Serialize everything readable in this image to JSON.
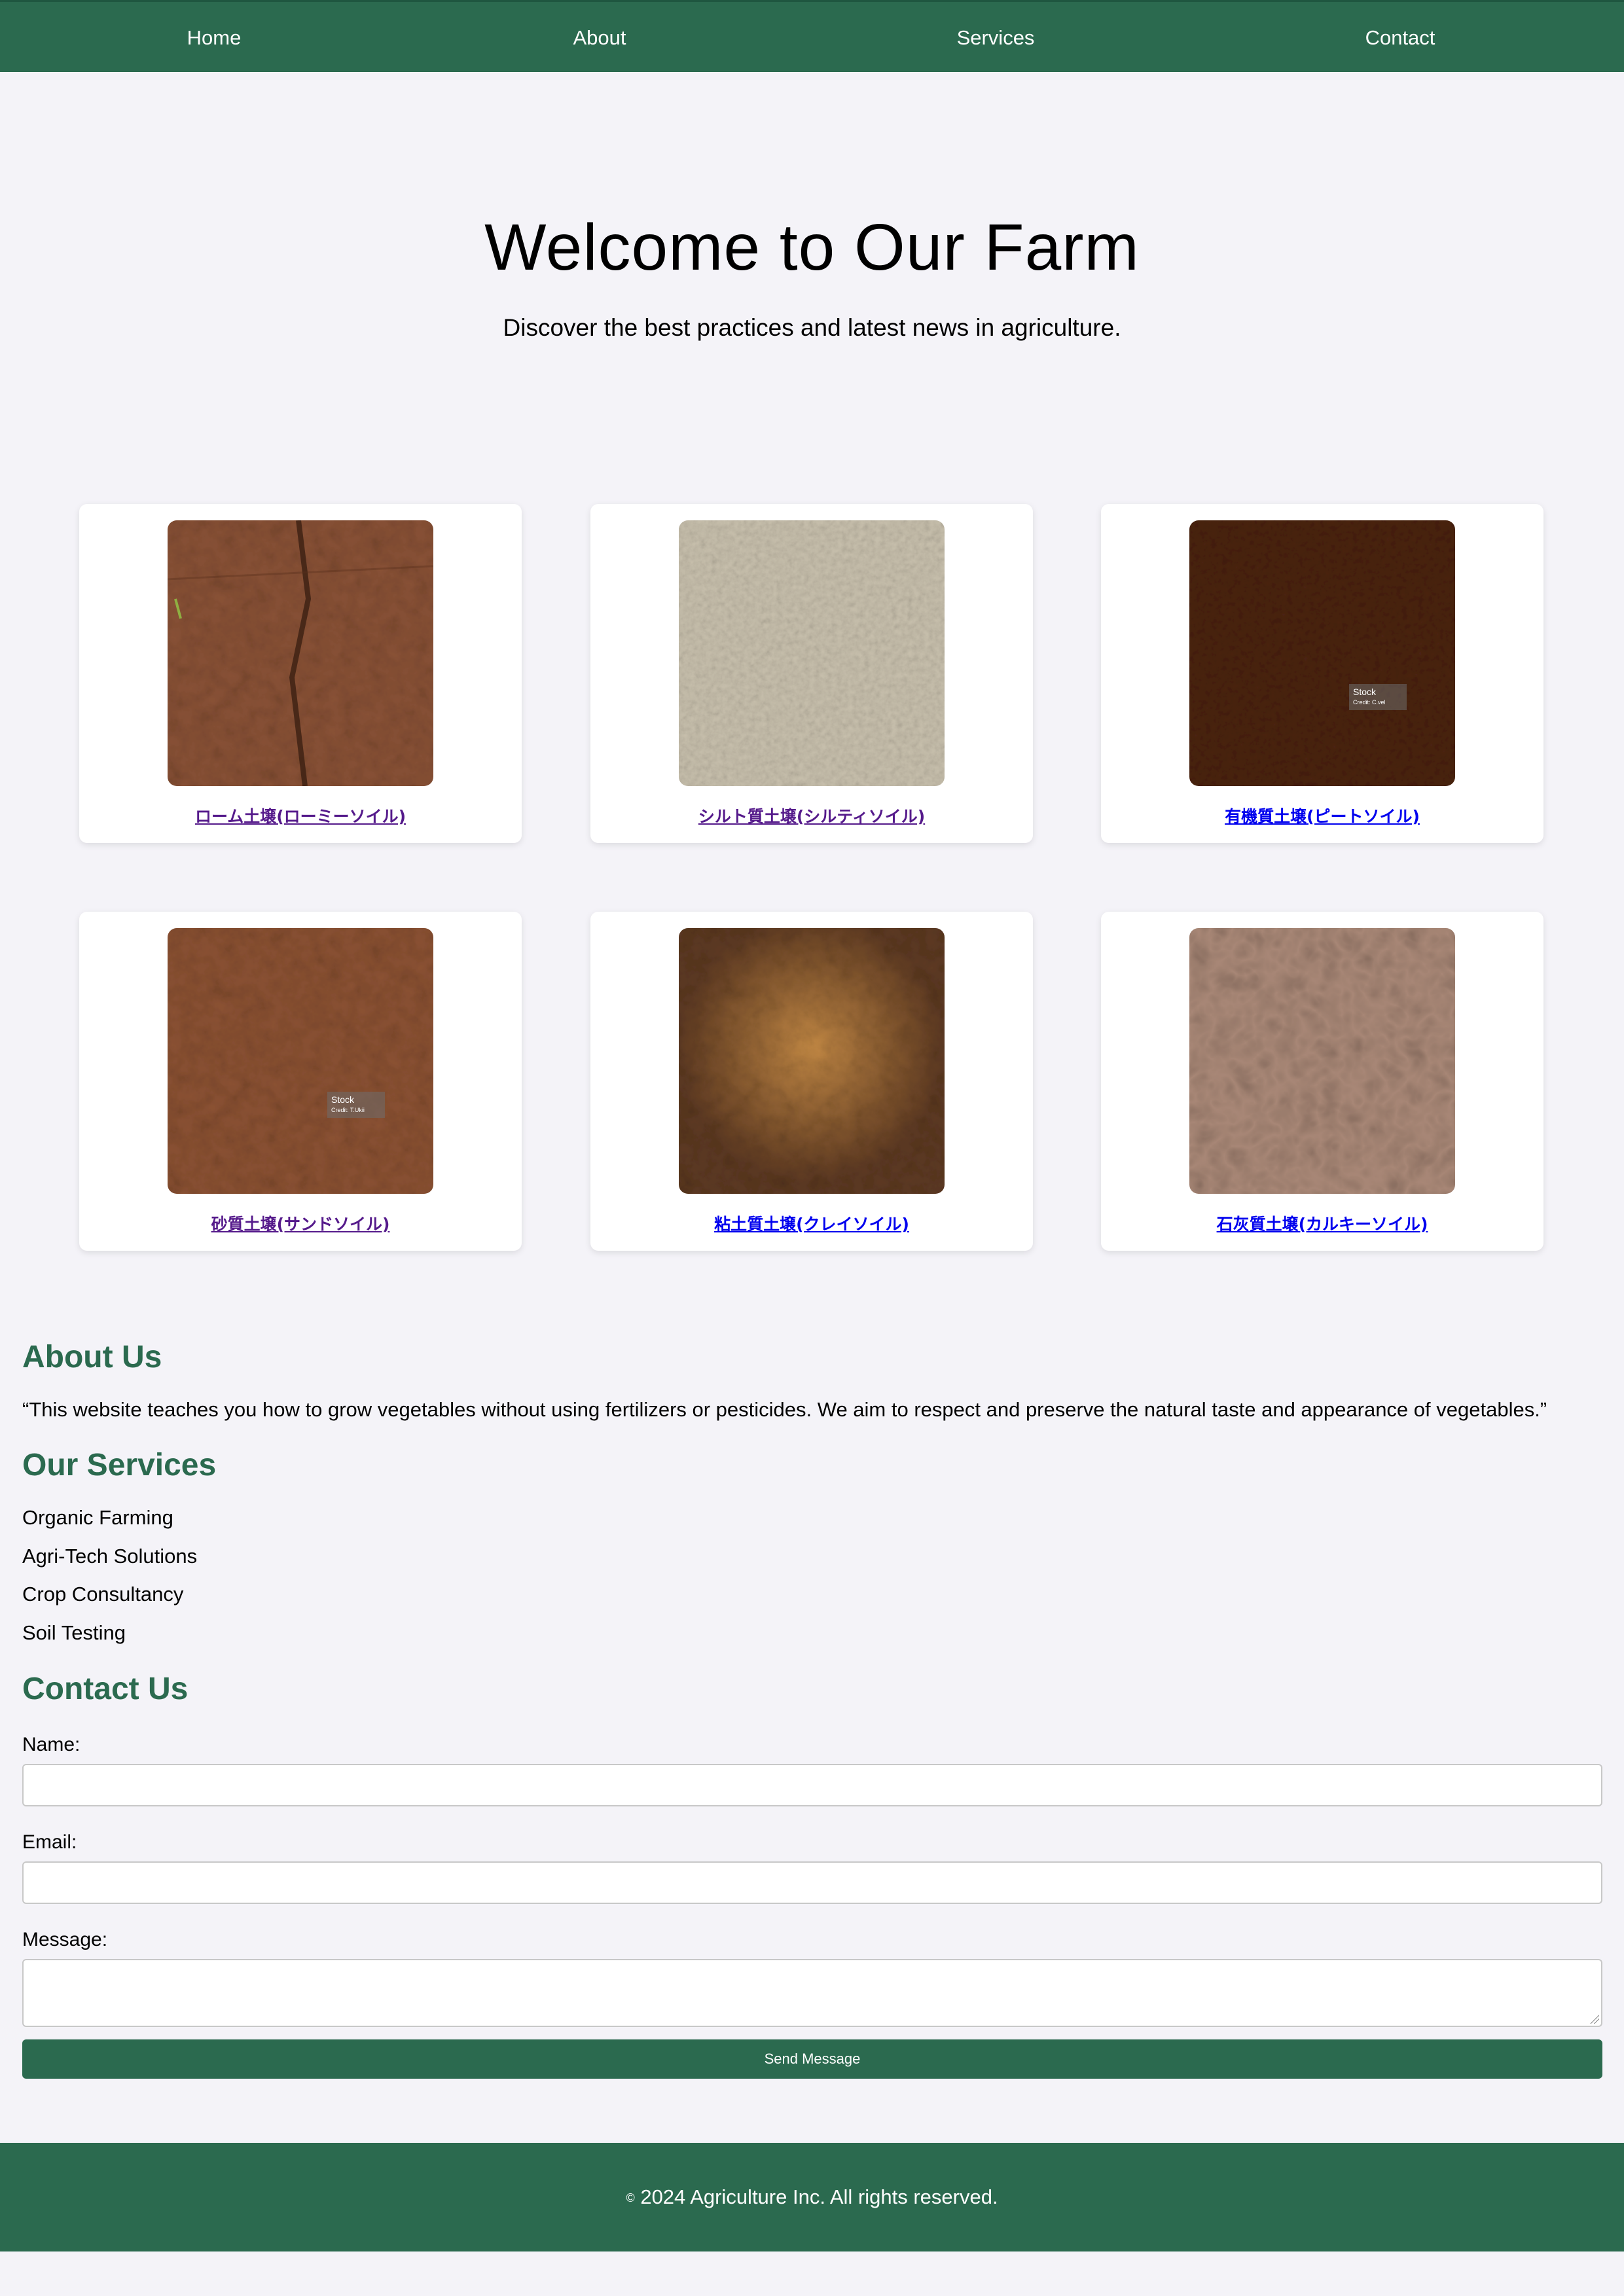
{
  "nav": {
    "items": [
      {
        "label": "Home"
      },
      {
        "label": "About"
      },
      {
        "label": "Services"
      },
      {
        "label": "Contact"
      }
    ]
  },
  "hero": {
    "title": "Welcome to Our Farm",
    "subtitle": "Discover the best practices and latest news in agriculture."
  },
  "soils": [
    {
      "label": "ローム土壌(ローミーソイル)",
      "visited": true,
      "image": "loamy-soil-photo"
    },
    {
      "label": "シルト質土壌(シルティソイル)",
      "visited": true,
      "image": "silty-soil-photo"
    },
    {
      "label": "有機質土壌(ピートソイル)",
      "visited": false,
      "image": "peat-soil-photo",
      "overlay": [
        "Stock",
        "Credit: C.vel"
      ]
    },
    {
      "label": "砂質土壌(サンドソイル)",
      "visited": true,
      "image": "sandy-soil-photo",
      "overlay": [
        "Stock",
        "Credit: T.Ukii"
      ]
    },
    {
      "label": "粘土質土壌(クレイソイル)",
      "visited": false,
      "image": "clay-soil-photo"
    },
    {
      "label": "石灰質土壌(カルキーソイル)",
      "visited": false,
      "image": "chalky-soil-photo"
    }
  ],
  "about": {
    "heading": "About Us",
    "text": "“This website teaches you how to grow vegetables without using fertilizers or pesticides. We aim to respect and preserve the natural taste and appearance of vegetables.”"
  },
  "services": {
    "heading": "Our Services",
    "items": [
      "Organic Farming",
      "Agri-Tech Solutions",
      "Crop Consultancy",
      "Soil Testing"
    ]
  },
  "contact": {
    "heading": "Contact Us",
    "name_label": "Name:",
    "name_value": "",
    "email_label": "Email:",
    "email_value": "",
    "message_label": "Message:",
    "message_value": "",
    "submit_label": "Send Message"
  },
  "footer": {
    "copyright_symbol": "©",
    "text": "2024 Agriculture Inc. All rights reserved."
  },
  "colors": {
    "primary": "#2b6a4f",
    "background": "#f4f3f8",
    "visited_link": "#551a8b",
    "link": "#0000ee"
  }
}
